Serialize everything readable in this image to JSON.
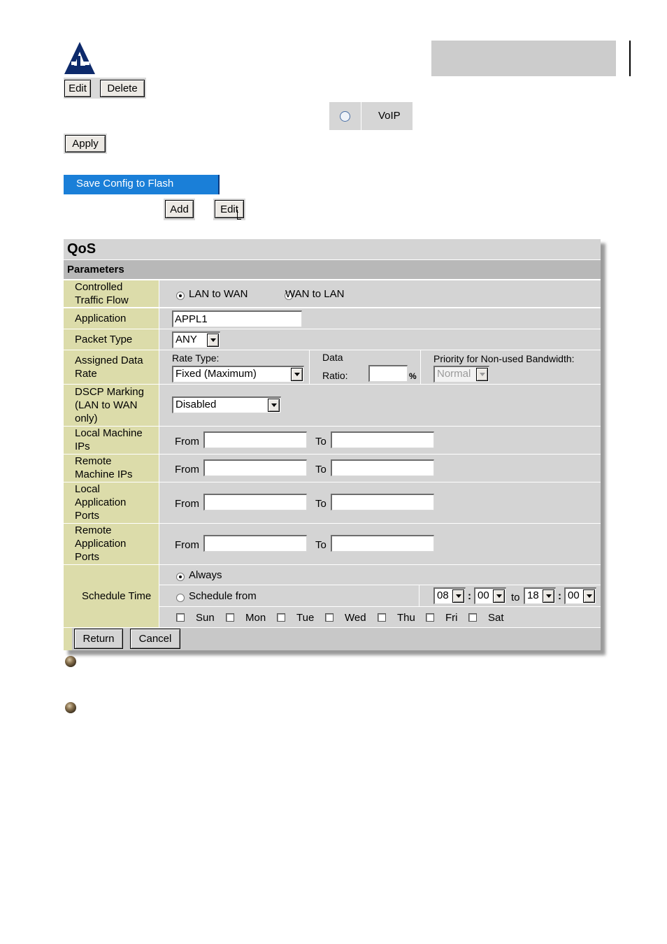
{
  "toolbar1": {
    "edit_label": "Edit",
    "delete_label": "Delete"
  },
  "voip": {
    "label": "VoIP"
  },
  "apply_label": "Apply",
  "save_config": {
    "label": "Save Config to Flash"
  },
  "toolbar2": {
    "add_label": "Add",
    "edit_label": "Edit"
  },
  "qos": {
    "title": "QoS",
    "section": "Parameters",
    "rows": {
      "traffic_flow": {
        "label": "Controlled Traffic Flow",
        "options": [
          "LAN to WAN",
          "WAN to LAN"
        ],
        "selected": "LAN to WAN"
      },
      "application": {
        "label": "Application",
        "value": "APPL1"
      },
      "packet_type": {
        "label": "Packet Type",
        "value": "ANY"
      },
      "assigned_rate": {
        "label": "Assigned Data Rate",
        "rate_type_label": "Rate Type:",
        "rate_type_value": "Fixed (Maximum)",
        "data_label": "Data",
        "ratio_label": "Ratio:",
        "ratio_value": "",
        "percent": "%",
        "priority_label": "Priority for Non-used Bandwidth:",
        "priority_value": "Normal"
      },
      "dscp": {
        "label": "DSCP Marking (LAN to WAN only)",
        "value": "Disabled"
      },
      "local_ips": {
        "label": "Local Machine IPs",
        "from_label": "From",
        "to_label": "To",
        "from_value": "",
        "to_value": ""
      },
      "remote_ips": {
        "label": "Remote Machine IPs",
        "from_label": "From",
        "to_label": "To",
        "from_value": "",
        "to_value": ""
      },
      "local_ports": {
        "label": "Local Application Ports",
        "from_label": "From",
        "to_label": "To",
        "from_value": "",
        "to_value": ""
      },
      "remote_ports": {
        "label": "Remote Application Ports",
        "from_label": "From",
        "to_label": "To",
        "from_value": "",
        "to_value": ""
      },
      "schedule": {
        "label": "Schedule Time",
        "always_label": "Always",
        "schedule_from_label": "Schedule from",
        "selected": "Always",
        "from_hour": "08",
        "from_min": "00",
        "to_label": "to",
        "to_hour": "18",
        "to_min": "00",
        "colon": ":",
        "days": [
          "Sun",
          "Mon",
          "Tue",
          "Wed",
          "Thu",
          "Fri",
          "Sat"
        ]
      }
    },
    "return_label": "Return",
    "cancel_label": "Cancel"
  },
  "colors": {
    "label_bg": "#dcdcaa",
    "value_bg": "#d4d4d4",
    "save_bg": "#1a7fd8"
  }
}
